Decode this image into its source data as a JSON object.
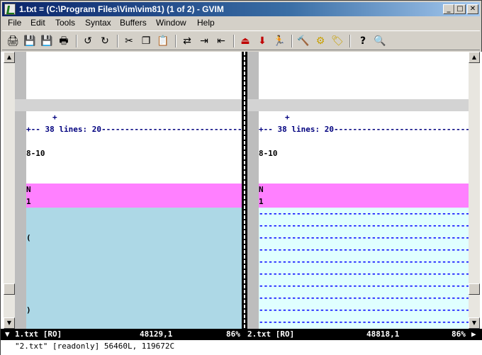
{
  "window": {
    "title": "1.txt = (C:\\Program Files\\Vim\\vim81) (1 of 2) - GVIM",
    "controls": {
      "minimize": "_",
      "maximize": "□",
      "close": "✕"
    }
  },
  "menu": [
    "File",
    "Edit",
    "Tools",
    "Syntax",
    "Buffers",
    "Window",
    "Help"
  ],
  "toolbar": {
    "icons": [
      "open-icon",
      "save-icon",
      "save-all-icon",
      "print-icon",
      "undo-icon",
      "redo-icon",
      "cut-icon",
      "copy-icon",
      "paste-icon",
      "replace-icon",
      "find-next-icon",
      "find-prev-icon",
      "load-session-icon",
      "save-session-icon",
      "run-script-icon",
      "make-icon",
      "run-ctags-icon",
      "jump-tag-icon",
      "help-icon",
      "find-help-icon"
    ]
  },
  "left_pane": {
    "fold_marker": "+",
    "fold_text": "+-- 38 lines: 20---------------------------------",
    "range_text": "8-10",
    "change_line1": "N",
    "change_line2": "1",
    "open_paren": "(",
    "close_paren": ")"
  },
  "right_pane": {
    "fold_marker": "+",
    "fold_text": "+-- 38 lines: 20--------------------------------------",
    "range_text": "8-10",
    "change_line1": "N",
    "change_line2": "1",
    "filler": "--------------------------------------------------------------"
  },
  "statusline": {
    "left": {
      "arrow": "▼",
      "file": "1.txt [RO]",
      "pos": "48129,1",
      "pct": "86%"
    },
    "right": {
      "file": "2.txt [RO]",
      "pos": "48818,1",
      "pct": "86%",
      "arrow": "▶"
    }
  },
  "cmdline": "\"2.txt\" [readonly] 56460L, 119672C",
  "colors": {
    "fold_bg": "#d3d3d3",
    "diff_change": "#ff80ff",
    "diff_add": "#add8e6",
    "diff_delete": "#e0ffff",
    "filler": "#0000ff"
  }
}
